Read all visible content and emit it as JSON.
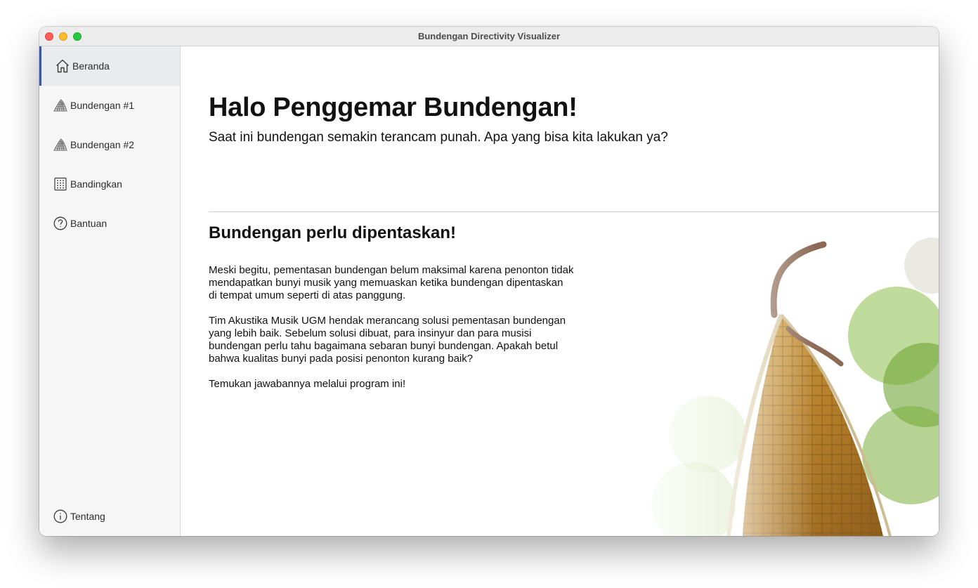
{
  "window": {
    "title": "Bundengan Directivity Visualizer"
  },
  "sidebar": {
    "items": [
      {
        "label": "Beranda",
        "icon": "home-icon",
        "active": true
      },
      {
        "label": "Bundengan #1",
        "icon": "bundengan-icon"
      },
      {
        "label": "Bundengan #2",
        "icon": "bundengan-icon"
      },
      {
        "label": "Bandingkan",
        "icon": "grid-icon"
      },
      {
        "label": "Bantuan",
        "icon": "help-icon"
      }
    ],
    "footer": {
      "label": "Tentang",
      "icon": "info-icon"
    }
  },
  "main": {
    "heading": "Halo Penggemar Bundengan!",
    "subtitle": "Saat ini bundengan semakin terancam punah. Apa yang bisa kita lakukan ya?",
    "section_heading": "Bundengan perlu dipentaskan!",
    "paragraphs": [
      "Meski begitu, pementasan bundengan belum maksimal karena penonton tidak mendapatkan bunyi musik yang memuaskan ketika bundengan dipentaskan di tempat umum seperti di atas panggung.",
      "Tim Akustika Musik UGM hendak merancang solusi pementasan bundengan yang lebih baik. Sebelum solusi dibuat, para insinyur dan para musisi bundengan perlu tahu bagaimana sebaran bunyi bundengan. Apakah betul bahwa kualitas bunyi pada posisi penonton kurang baik?",
      "Temukan jawabannya melalui program ini!"
    ]
  },
  "colors": {
    "accent": "#3d55a6",
    "sidebar_bg": "#f6f6f7",
    "active_bg": "#eaebec",
    "traffic_close": "#ff5f57",
    "traffic_min": "#febc2e",
    "traffic_max": "#28c840"
  }
}
